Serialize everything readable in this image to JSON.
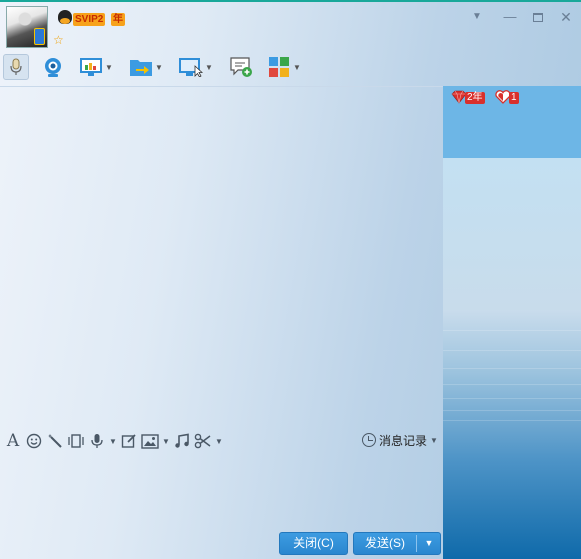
{
  "header": {
    "vip_badge": "SVIP2",
    "vip_year": "年",
    "star": "☆",
    "window_controls": [
      "dropdown-arrow",
      "minimize",
      "maximize",
      "close"
    ]
  },
  "toolbar": {
    "items": [
      {
        "name": "voice-call",
        "icon": "microphone-icon"
      },
      {
        "name": "video-call",
        "icon": "webcam-icon"
      },
      {
        "name": "remote-screen",
        "icon": "monitor-chart-icon",
        "has_dropdown": true
      },
      {
        "name": "send-file",
        "icon": "folder-arrow-icon",
        "has_dropdown": true
      },
      {
        "name": "remote-assist",
        "icon": "monitor-cursor-icon",
        "has_dropdown": true
      },
      {
        "name": "create-discussion",
        "icon": "chat-add-icon"
      },
      {
        "name": "apps",
        "icon": "app-grid-icon",
        "has_dropdown": true
      }
    ]
  },
  "right_pane": {
    "badges": [
      {
        "icon": "red-diamond-icon",
        "label": "2年"
      },
      {
        "icon": "red-heart-icon",
        "label": "1"
      }
    ]
  },
  "edit_toolbar": {
    "items": [
      "font-icon",
      "emoji-icon",
      "magic-wand-icon",
      "shake-window-icon",
      "voice-message-icon",
      "edit-note-icon",
      "image-icon",
      "music-icon",
      "scissors-icon"
    ],
    "history_label": "消息记录"
  },
  "buttons": {
    "close_label": "关闭(C)",
    "send_label": "发送(S)"
  },
  "colors": {
    "accent": "#2a86cf",
    "topline": "#19a89a",
    "right_pane_top": "#6db6e6",
    "right_pane_bottom": "#0f6aaa"
  }
}
